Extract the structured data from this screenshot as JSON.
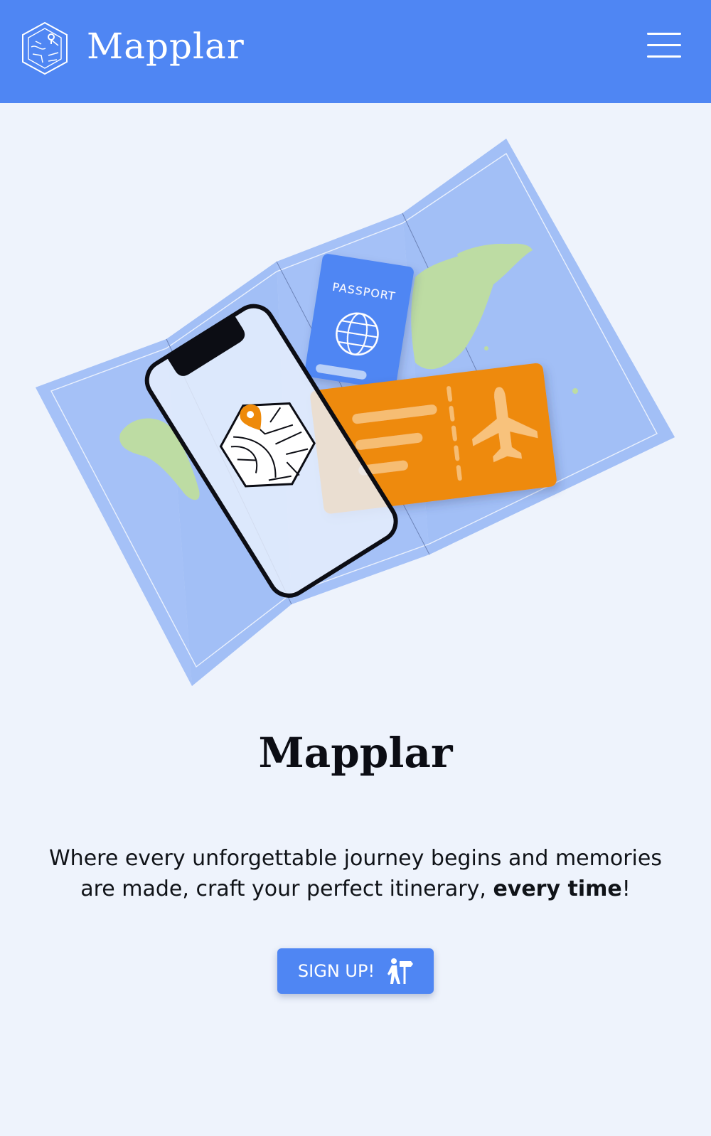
{
  "header": {
    "brand_name": "Mapplar",
    "logo_icon": "map-hexagon-logo-icon",
    "menu_icon": "hamburger-menu-icon"
  },
  "hero": {
    "illustration": {
      "passport_label": "PASSPORT",
      "icons": [
        "folded-map-icon",
        "smartphone-icon",
        "passport-icon",
        "globe-icon",
        "plane-ticket-icon",
        "airplane-icon",
        "location-pin-icon"
      ]
    },
    "title": "Mapplar",
    "tagline_lead": "Where every unforgettable journey begins and memories are made, craft your perfect itinerary, ",
    "tagline_emphasis": "every time",
    "tagline_end": "!",
    "signup_label": "SIGN UP!",
    "signup_icon": "hiker-signpost-icon"
  },
  "colors": {
    "brand_blue": "#4f86f3",
    "page_background": "#eef3fc",
    "map_blue": "#a5c1f7",
    "land_green": "#bddca3",
    "ticket_orange": "#ee8a0a",
    "text_dark": "#0c0d14"
  }
}
